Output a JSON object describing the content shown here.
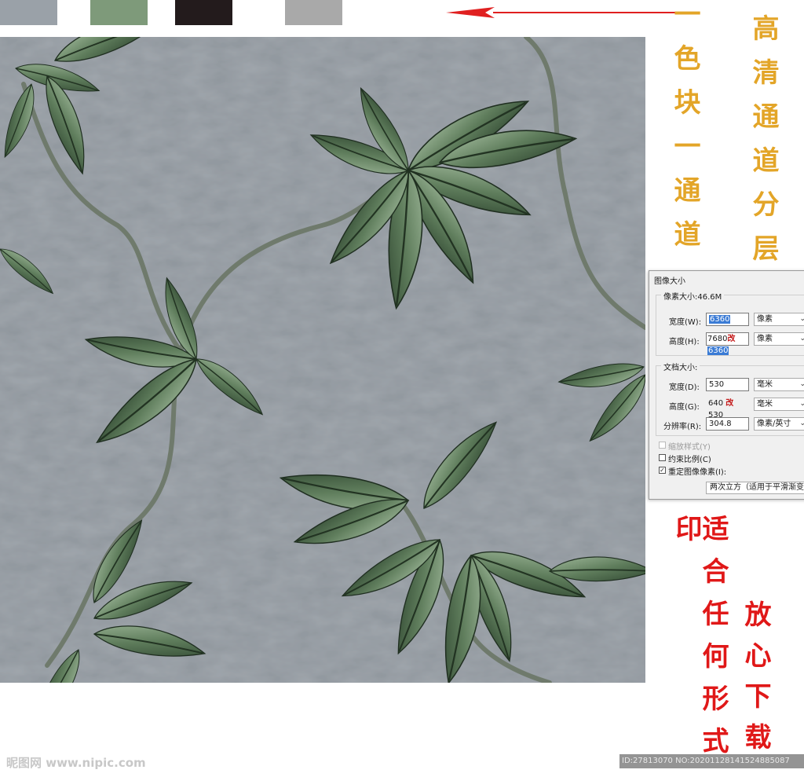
{
  "colors": {
    "swatch_1": "#9aa1a8",
    "swatch_2": "#7e9a7a",
    "swatch_3": "#231b1c",
    "swatch_4": "#a9a9a9",
    "arrow": "#e02020",
    "gold": "#e3a528",
    "red": "#e01818",
    "background": "#8e959c"
  },
  "annotations": {
    "one_color_one_channel": "一色块一通道",
    "hd_channel_layers": "高清通道分层",
    "suits_any_print": "适合任何形式印",
    "safe_download": "放心下载"
  },
  "dialog": {
    "title": "图像大小",
    "pixel_size_label": "像素大小:46.6M",
    "width_label": "宽度(W):",
    "width_value": "6360",
    "height_label": "高度(H):",
    "height_value_old": "7680",
    "height_change_mark": "改",
    "height_value": "6360",
    "unit_pixels": "像素",
    "doc_size_label": "文档大小:",
    "doc_width_label": "宽度(D):",
    "doc_width_value": "530",
    "doc_height_label": "高度(G):",
    "doc_height_old": "640",
    "doc_height_mark": "改",
    "doc_height_value": "530",
    "unit_mm": "毫米",
    "resolution_label": "分辨率(R):",
    "resolution_value": "304.8",
    "unit_ppi": "像素/英寸",
    "scale_styles": "缩放样式(Y)",
    "constrain": "约束比例(C)",
    "resample": "重定图像像素(I):",
    "resample_method": "两次立方（适用于平滑渐变"
  },
  "icons": {
    "arrow": "left-arrow-icon"
  },
  "watermark": {
    "site": "昵图网 www.nipic.com",
    "id": "ID:27813070 NO:20201128141524885087"
  }
}
